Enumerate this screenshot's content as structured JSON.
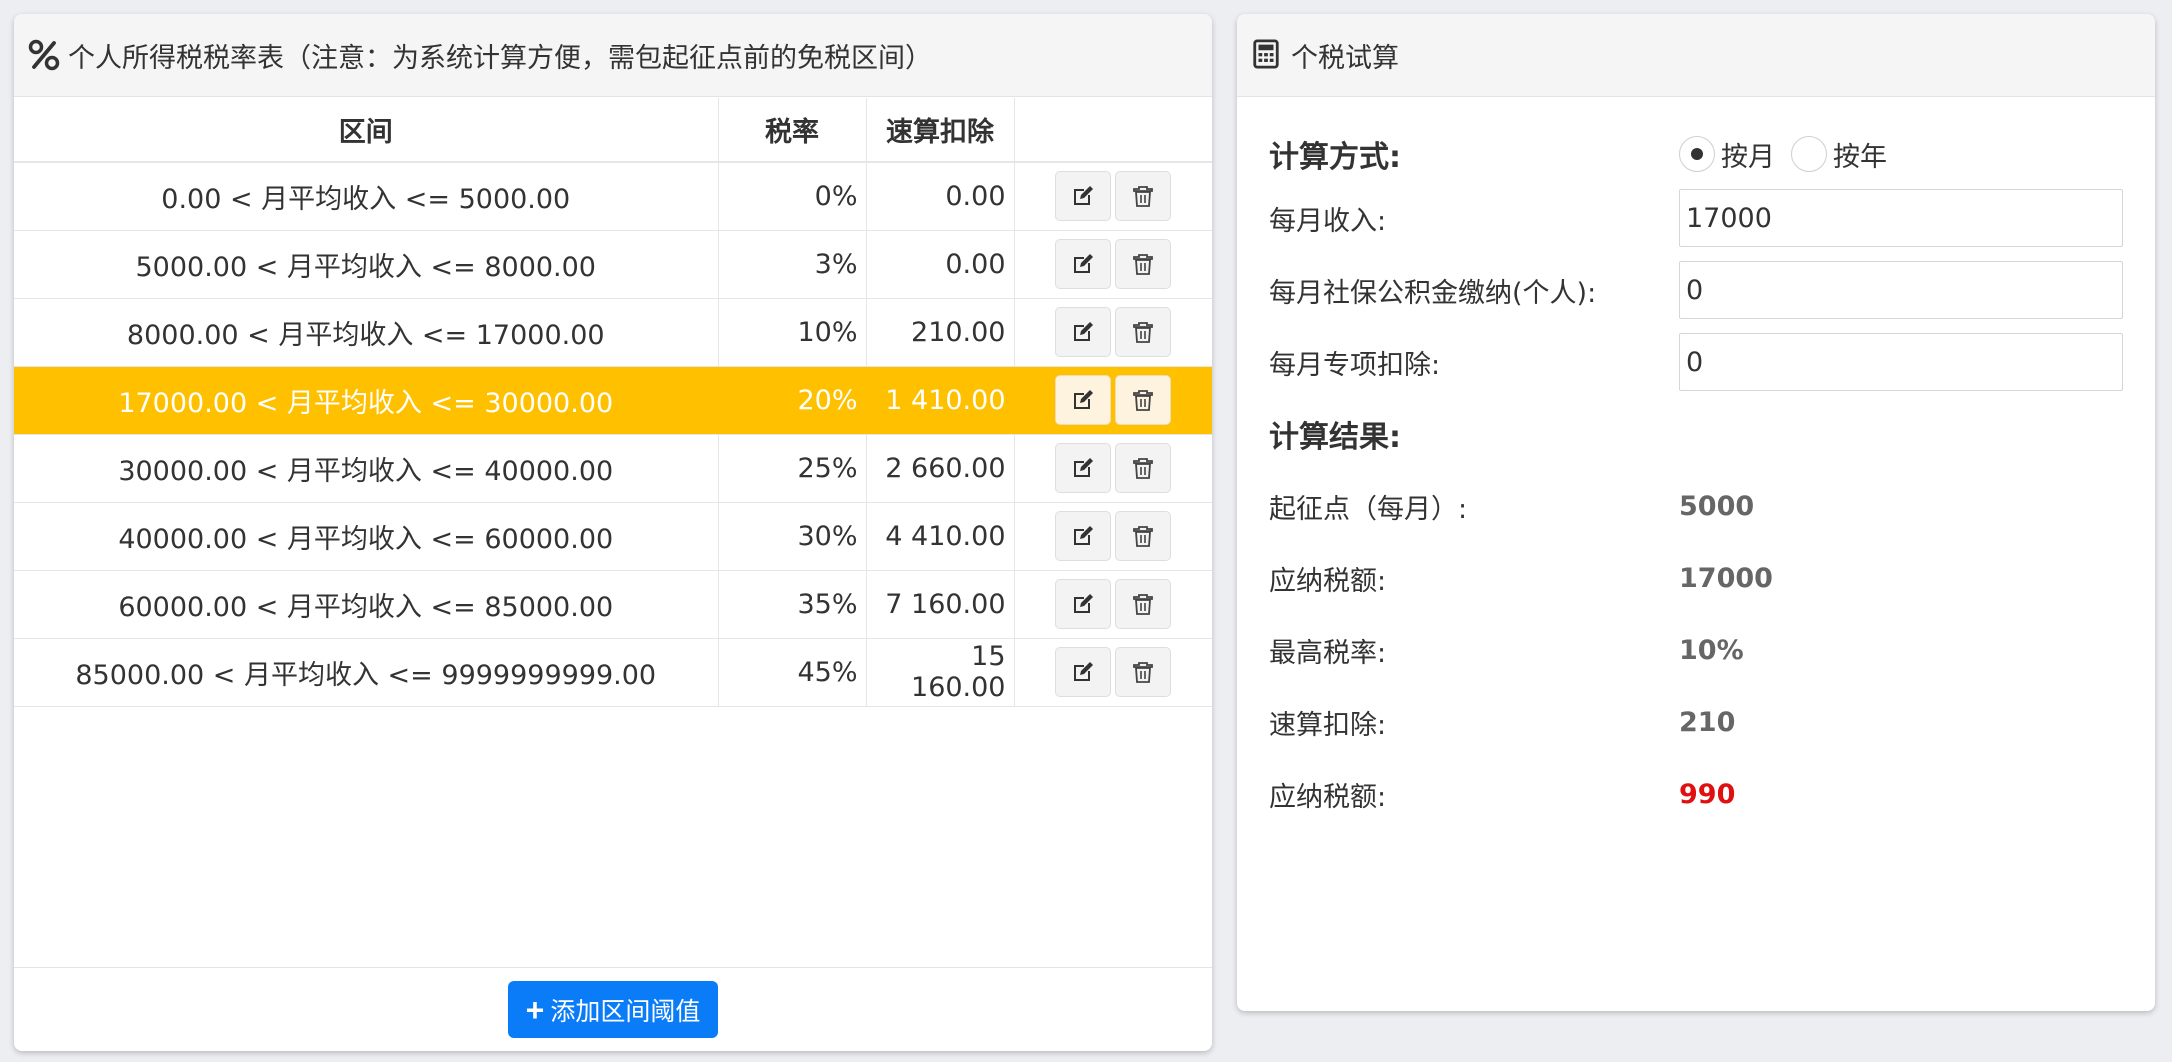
{
  "left_panel": {
    "title": "个人所得税税率表（注意：为系统计算方便，需包起征点前的免税区间）",
    "icon": "percent-icon",
    "columns": [
      "区间",
      "税率",
      "速算扣除",
      ""
    ],
    "rows": [
      {
        "range": "0.00 < 月平均收入 <= 5000.00",
        "rate": "0%",
        "quick": "0.00"
      },
      {
        "range": "5000.00 < 月平均收入 <= 8000.00",
        "rate": "3%",
        "quick": "0.00"
      },
      {
        "range": "8000.00 < 月平均收入 <= 17000.00",
        "rate": "10%",
        "quick": "210.00"
      },
      {
        "range": "17000.00 < 月平均收入 <= 30000.00",
        "rate": "20%",
        "quick": "1 410.00"
      },
      {
        "range": "30000.00 < 月平均收入 <= 40000.00",
        "rate": "25%",
        "quick": "2 660.00"
      },
      {
        "range": "40000.00 < 月平均收入 <= 60000.00",
        "rate": "30%",
        "quick": "4 410.00"
      },
      {
        "range": "60000.00 < 月平均收入 <= 85000.00",
        "rate": "35%",
        "quick": "7 160.00"
      },
      {
        "range": "85000.00 < 月平均收入 <= 9999999999.00",
        "rate": "45%",
        "quick": "15 160.00"
      }
    ],
    "highlight_color": "#ffc000",
    "add_button": "添加区间阈值",
    "accent": "#0b7cf8"
  },
  "right_panel": {
    "title": "个税试算",
    "icon": "calculator-icon",
    "calc_method_label": "计算方式:",
    "method_options": [
      "按月",
      "按年"
    ],
    "selected_method": "按月",
    "monthly_income_label": "每月收入:",
    "monthly_income_value": "17000",
    "social_label": "每月社保公积金缴纳(个人):",
    "social_value": "0",
    "special_label": "每月专项扣除:",
    "special_value": "0",
    "result_label": "计算结果:",
    "threshold_label": "起征点（每月）:",
    "threshold_value": "5000",
    "taxable_label": "应纳税额:",
    "taxable_value": "17000",
    "max_rate_label": "最高税率:",
    "max_rate_value": "10%",
    "quick_deduct_label": "速算扣除:",
    "quick_deduct_value": "210",
    "tax_due_label": "应纳税额:",
    "tax_due_value": "990",
    "tax_due_color": "#e01010"
  }
}
